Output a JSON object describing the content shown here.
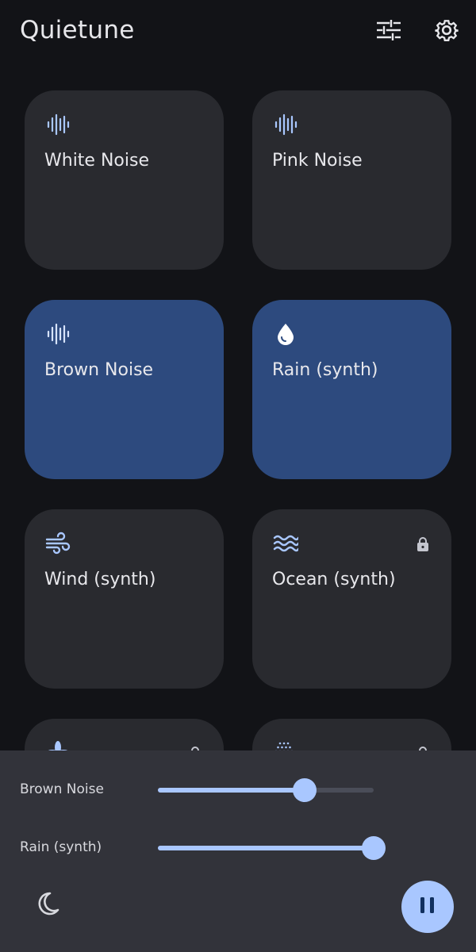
{
  "app": {
    "title": "Quietune"
  },
  "toolbar": {
    "mixer_icon": "tune-icon",
    "settings_icon": "gear-icon"
  },
  "colors": {
    "background": "#121317",
    "tile": "#292a2f",
    "tile_active": "#2d4a7e",
    "accent": "#a9c7ff",
    "sheet": "#32333a"
  },
  "sounds": [
    {
      "label": "White Noise",
      "icon": "waveform-icon",
      "active": false,
      "locked": false
    },
    {
      "label": "Pink Noise",
      "icon": "waveform-icon",
      "active": false,
      "locked": false
    },
    {
      "label": "Brown Noise",
      "icon": "waveform-icon",
      "active": true,
      "locked": false
    },
    {
      "label": "Rain (synth)",
      "icon": "water-drop-icon",
      "active": true,
      "locked": false
    },
    {
      "label": "Wind (synth)",
      "icon": "wind-icon",
      "active": false,
      "locked": false
    },
    {
      "label": "Ocean (synth)",
      "icon": "waves-icon",
      "active": false,
      "locked": true
    },
    {
      "label": "",
      "icon": "fan-icon",
      "active": false,
      "locked": true
    },
    {
      "label": "",
      "icon": "dotted-grid-icon",
      "active": false,
      "locked": true
    }
  ],
  "mixer": [
    {
      "label": "Brown Noise",
      "level": 0.68
    },
    {
      "label": "Rain (synth)",
      "level": 1.0
    }
  ],
  "controls": {
    "sleep_timer_icon": "moon-icon",
    "play_state_icon": "pause-icon"
  }
}
